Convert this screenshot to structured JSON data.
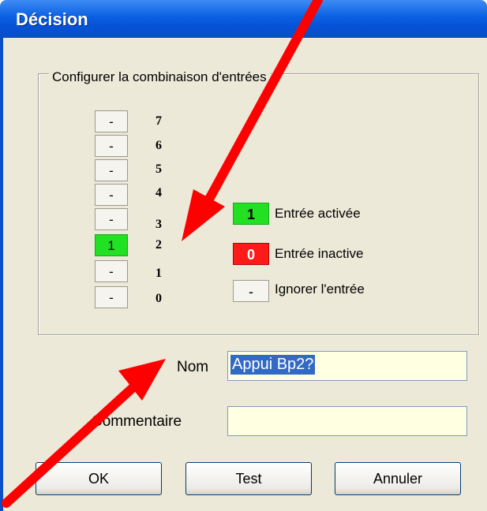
{
  "window": {
    "title": "Décision"
  },
  "group": {
    "label": "Configurer la combinaison d'entrées",
    "bits": [
      {
        "number": "7",
        "value": "-",
        "state": "ignore"
      },
      {
        "number": "6",
        "value": "-",
        "state": "ignore"
      },
      {
        "number": "5",
        "value": "-",
        "state": "ignore"
      },
      {
        "number": "4",
        "value": "-",
        "state": "ignore"
      },
      {
        "number": "3",
        "value": "-",
        "state": "ignore"
      },
      {
        "number": "2",
        "value": "1",
        "state": "active"
      },
      {
        "number": "1",
        "value": "-",
        "state": "ignore"
      },
      {
        "number": "0",
        "value": "-",
        "state": "ignore"
      }
    ],
    "legend": [
      {
        "symbol": "1",
        "text": "Entrée activée",
        "color": "#22e022"
      },
      {
        "symbol": "0",
        "text": "Entrée inactive",
        "color": "#ff1a1a"
      },
      {
        "symbol": "-",
        "text": "Ignorer l'entrée",
        "color": "#f5f4ee"
      }
    ]
  },
  "form": {
    "nom_label": "Nom",
    "nom_value": "Appui Bp2?",
    "commentaire_label": "Commentaire",
    "commentaire_value": ""
  },
  "buttons": {
    "ok": "OK",
    "test": "Test",
    "annuler": "Annuler"
  },
  "annotation": {
    "arrow_color": "#ff0000",
    "arrow_count": 2
  }
}
